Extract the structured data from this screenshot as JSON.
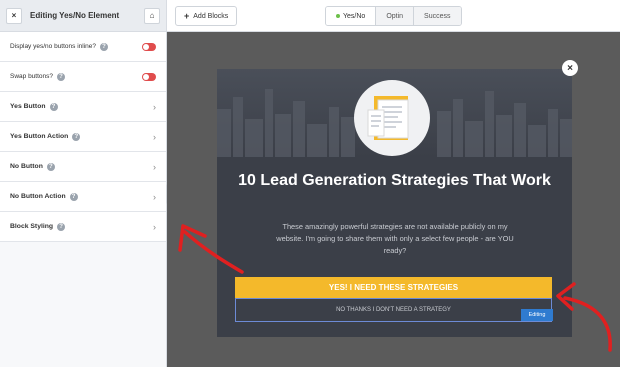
{
  "sidebar": {
    "close_label": "×",
    "title": "Editing Yes/No Element",
    "home_icon": "⌂",
    "rows": [
      {
        "label": "Display yes/no buttons inline?",
        "control": "toggle"
      },
      {
        "label": "Swap buttons?",
        "control": "toggle"
      },
      {
        "label": "Yes Button",
        "control": "chevron"
      },
      {
        "label": "Yes Button Action",
        "control": "chevron"
      },
      {
        "label": "No Button",
        "control": "chevron"
      },
      {
        "label": "No Button Action",
        "control": "chevron"
      },
      {
        "label": "Block Styling",
        "control": "chevron"
      }
    ],
    "collapse_icon": "‹"
  },
  "topbar": {
    "add_blocks_label": "Add Blocks",
    "tabs": [
      {
        "label": "Yes/No",
        "active": true
      },
      {
        "label": "Optin",
        "active": false
      },
      {
        "label": "Success",
        "active": false
      }
    ]
  },
  "popup": {
    "headline": "10 Lead Generation Strategies That Work",
    "body": "These amazingly powerful strategies are not available publicly on my website. I'm going to share them with only a select few people - are YOU ready?",
    "yes_button": "YES! I NEED THESE STRATEGIES",
    "no_button": "NO THANKS I DON'T NEED A STRATEGY",
    "editing_badge": "Editing",
    "close_icon": "×"
  },
  "colors": {
    "accent_yellow": "#f4b92b",
    "toggle_red": "#e04c4c",
    "editing_blue": "#2f7bd0",
    "annotation_red": "#e02020"
  }
}
